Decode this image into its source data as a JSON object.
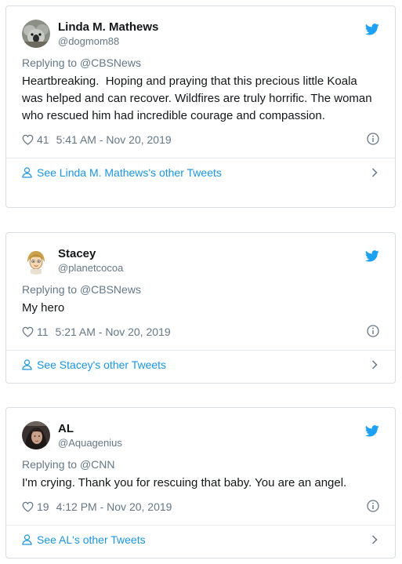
{
  "accent_color": "#1da1f2",
  "tweets": [
    {
      "name": "Linda M. Mathews",
      "handle": "@dogmom88",
      "avatar_icon": "koala-photo-avatar",
      "replying_label": "Replying to",
      "replying_to": "@CBSNews",
      "text": "Heartbreaking.  Hoping and praying that this precious little Koala was helped and can recover. Wildfires are truly horrific. The woman who rescued him had incredible courage and compassion.",
      "likes": "41",
      "timestamp": "5:41 AM - Nov 20, 2019",
      "see_more": "See Linda M. Mathews's other Tweets"
    },
    {
      "name": "Stacey",
      "handle": "@planetcocoa",
      "avatar_icon": "emoji-girl-avatar",
      "replying_label": "Replying to",
      "replying_to": "@CBSNews",
      "text": "My hero",
      "likes": "11",
      "timestamp": "5:21 AM - Nov 20, 2019",
      "see_more": "See Stacey's other Tweets"
    },
    {
      "name": "AL",
      "handle": "@Aquagenius",
      "avatar_icon": "woman-photo-avatar",
      "replying_label": "Replying to",
      "replying_to": "@CNN",
      "text": "I'm crying. Thank you for rescuing that baby. You are an angel.",
      "likes": "19",
      "timestamp": "4:12 PM - Nov 20, 2019",
      "see_more": "See AL's other Tweets"
    }
  ]
}
